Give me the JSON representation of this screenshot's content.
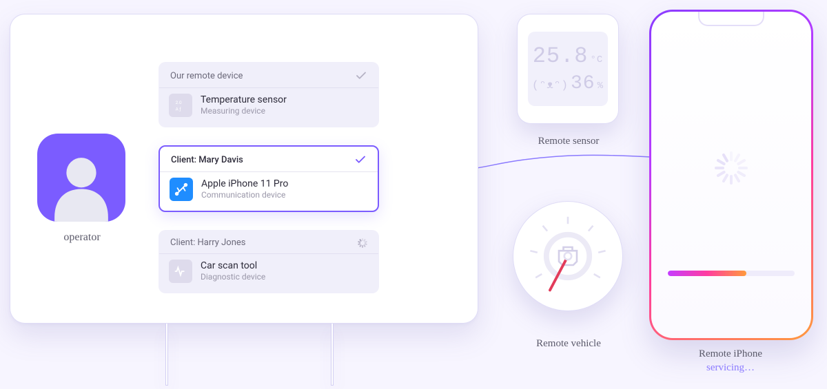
{
  "operator": {
    "label": "operator"
  },
  "cards": [
    {
      "header": "Our remote device",
      "title": "Temperature sensor",
      "sub": "Measuring device",
      "status": "done",
      "iconName": "thermo-chip-icon"
    },
    {
      "header": "Client: Mary Davis",
      "title": "Apple iPhone 11 Pro",
      "sub": "Communication device",
      "status": "selected",
      "iconName": "usb-icon"
    },
    {
      "header": "Client: Harry Jones",
      "title": "Car scan tool",
      "sub": "Diagnostic device",
      "status": "loading",
      "iconName": "ecg-icon"
    }
  ],
  "sensor": {
    "caption": "Remote sensor",
    "temperature_value": "25.8",
    "temperature_unit": "°C",
    "face": "(ᵔᴥᵔ)",
    "humidity_value": "36",
    "humidity_unit": "%"
  },
  "vehicle": {
    "caption": "Remote vehicle"
  },
  "phone": {
    "caption": "Remote iPhone",
    "status": "servicing…",
    "progress_pct": 62
  }
}
